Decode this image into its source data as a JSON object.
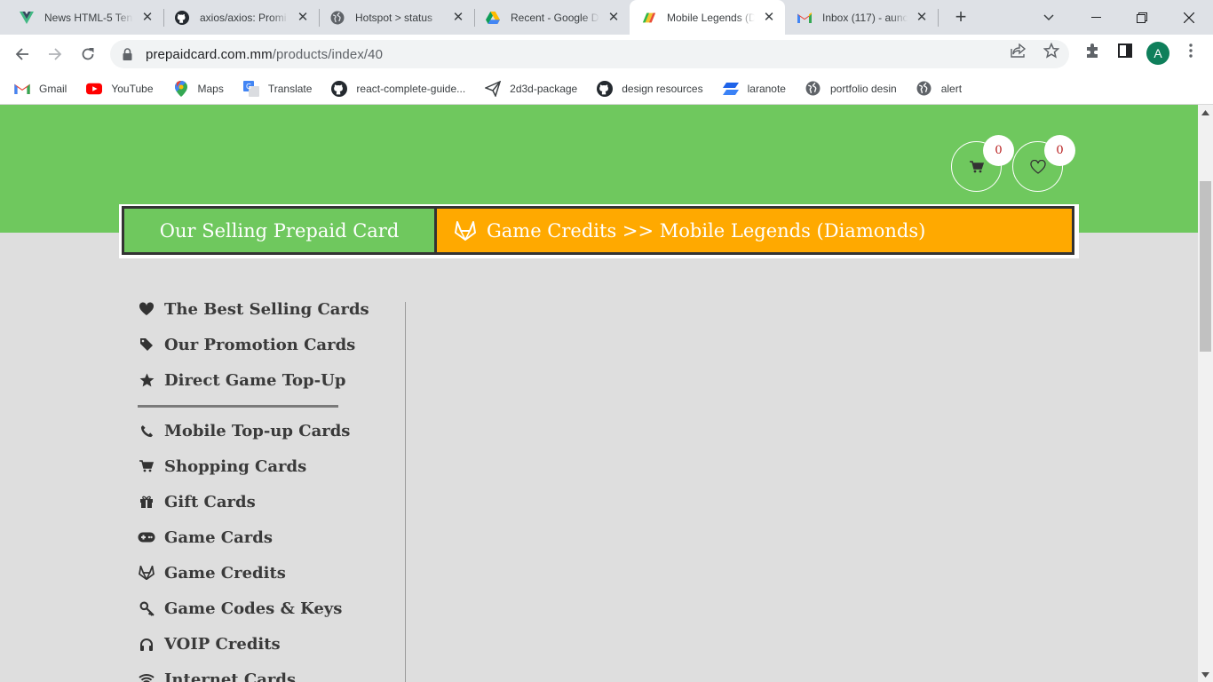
{
  "browser": {
    "tabs": [
      {
        "title": "News HTML-5 Ten",
        "icon": "vue-icon"
      },
      {
        "title": "axios/axios: Promi",
        "icon": "github-icon"
      },
      {
        "title": "Hotspot > status",
        "icon": "globe-icon"
      },
      {
        "title": "Recent - Google D",
        "icon": "google-drive-icon"
      },
      {
        "title": "Mobile Legends (D",
        "icon": "mobile-legends-icon",
        "active": true
      },
      {
        "title": "Inbox (117) - aunc",
        "icon": "gmail-icon"
      }
    ],
    "url_domain": "prepaidcard.com.mm",
    "url_path": "/products/index/40",
    "profile_initial": "A",
    "bookmarks": [
      {
        "label": "Gmail",
        "icon": "gmail-icon"
      },
      {
        "label": "YouTube",
        "icon": "youtube-icon"
      },
      {
        "label": "Maps",
        "icon": "maps-icon"
      },
      {
        "label": "Translate",
        "icon": "translate-icon"
      },
      {
        "label": "react-complete-guide...",
        "icon": "github-icon"
      },
      {
        "label": "2d3d-package",
        "icon": "send-icon"
      },
      {
        "label": "design resources",
        "icon": "github-icon"
      },
      {
        "label": "laranote",
        "icon": "laranote-icon"
      },
      {
        "label": "portfolio desin",
        "icon": "globe-icon"
      },
      {
        "label": "alert",
        "icon": "globe-icon"
      }
    ]
  },
  "header": {
    "cart_count": "0",
    "wishlist_count": "0",
    "colors": {
      "green": "#6fc85e",
      "orange": "#ffa900",
      "badge_text": "#b71c1c"
    }
  },
  "titlebar": {
    "left": "Our Selling Prepaid Card",
    "breadcrumb": "Game Credits >> Mobile Legends (Diamonds)"
  },
  "sidebar": {
    "featured": [
      {
        "label": "The Best Selling Cards",
        "icon": "heart-icon"
      },
      {
        "label": "Our Promotion Cards",
        "icon": "tag-icon"
      },
      {
        "label": "Direct Game Top-Up",
        "icon": "star-icon"
      }
    ],
    "categories": [
      {
        "label": "Mobile Top-up Cards",
        "icon": "phone-icon"
      },
      {
        "label": "Shopping Cards",
        "icon": "cart-icon"
      },
      {
        "label": "Gift Cards",
        "icon": "gift-icon"
      },
      {
        "label": "Game Cards",
        "icon": "gamepad-icon"
      },
      {
        "label": "Game Credits",
        "icon": "gitlab-fox-icon"
      },
      {
        "label": "Game Codes & Keys",
        "icon": "key-icon"
      },
      {
        "label": "VOIP Credits",
        "icon": "headphones-icon"
      },
      {
        "label": "Internet Cards",
        "icon": "wifi-icon"
      }
    ]
  }
}
